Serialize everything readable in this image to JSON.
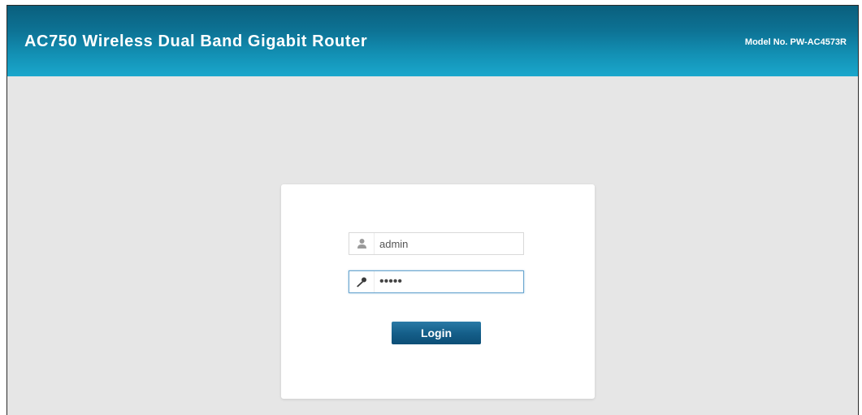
{
  "header": {
    "title": "AC750 Wireless Dual Band Gigabit Router",
    "model": "Model No. PW-AC4573R",
    "gradient_top": "#0a5f7d",
    "gradient_bottom": "#1aa7cc"
  },
  "login": {
    "username_icon": "user-icon",
    "username_value": "admin",
    "password_icon": "key-icon",
    "password_value": "admin",
    "button_label": "Login",
    "button_color": "#155f8a"
  },
  "colors": {
    "page_background": "#e6e6e6",
    "card_background": "#ffffff"
  }
}
